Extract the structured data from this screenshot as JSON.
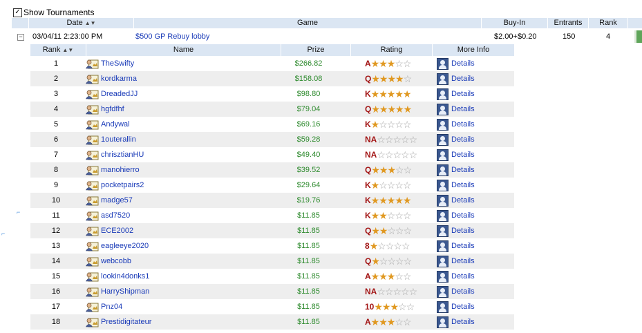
{
  "show_tournaments": {
    "label": "Show Tournaments",
    "checked": "✓"
  },
  "outer_headers": {
    "date": "Date",
    "game": "Game",
    "buyin": "Buy-In",
    "entrants": "Entrants",
    "rank": "Rank"
  },
  "tournament": {
    "expander": "−",
    "date": "03/04/11 2:23:00 PM",
    "game": "$500 GP Rebuy lobby",
    "buyin": "$2.00+$0.20",
    "entrants": "150",
    "rank": "4"
  },
  "inner_headers": {
    "rank": "Rank",
    "name": "Name",
    "prize": "Prize",
    "rating": "Rating",
    "more_info": "More Info"
  },
  "players": [
    {
      "rank": "1",
      "name": "TheSwifty",
      "prize": "$266.82",
      "grade": "A",
      "stars": 3,
      "details": "Details"
    },
    {
      "rank": "2",
      "name": "kordkarma",
      "prize": "$158.08",
      "grade": "Q",
      "stars": 4,
      "details": "Details"
    },
    {
      "rank": "3",
      "name": "DreadedJJ",
      "prize": "$98.80",
      "grade": "K",
      "stars": 5,
      "details": "Details"
    },
    {
      "rank": "4",
      "name": "hgfdfhf",
      "prize": "$79.04",
      "grade": "Q",
      "stars": 5,
      "details": "Details"
    },
    {
      "rank": "5",
      "name": "Andywal",
      "prize": "$69.16",
      "grade": "K",
      "stars": 1,
      "details": "Details"
    },
    {
      "rank": "6",
      "name": "1outerallin",
      "prize": "$59.28",
      "grade": "NA",
      "stars": 0,
      "details": "Details"
    },
    {
      "rank": "7",
      "name": "chrisztianHU",
      "prize": "$49.40",
      "grade": "NA",
      "stars": 0,
      "details": "Details"
    },
    {
      "rank": "8",
      "name": "manohierro",
      "prize": "$39.52",
      "grade": "Q",
      "stars": 3,
      "details": "Details"
    },
    {
      "rank": "9",
      "name": "pocketpairs2",
      "prize": "$29.64",
      "grade": "K",
      "stars": 1,
      "details": "Details"
    },
    {
      "rank": "10",
      "name": "madge57",
      "prize": "$19.76",
      "grade": "K",
      "stars": 5,
      "details": "Details"
    },
    {
      "rank": "11",
      "name": "asd7520",
      "prize": "$11.85",
      "grade": "K",
      "stars": 2,
      "details": "Details"
    },
    {
      "rank": "12",
      "name": "ECE2002",
      "prize": "$11.85",
      "grade": "Q",
      "stars": 2,
      "details": "Details"
    },
    {
      "rank": "13",
      "name": "eagleeye2020",
      "prize": "$11.85",
      "grade": "8",
      "stars": 1,
      "details": "Details"
    },
    {
      "rank": "14",
      "name": "webcobb",
      "prize": "$11.85",
      "grade": "Q",
      "stars": 1,
      "details": "Details"
    },
    {
      "rank": "15",
      "name": "lookin4donks1",
      "prize": "$11.85",
      "grade": "A",
      "stars": 3,
      "details": "Details"
    },
    {
      "rank": "16",
      "name": "HarryShipman",
      "prize": "$11.85",
      "grade": "NA",
      "stars": 0,
      "details": "Details"
    },
    {
      "rank": "17",
      "name": "Pnz04",
      "prize": "$11.85",
      "grade": "10",
      "stars": 3,
      "details": "Details"
    },
    {
      "rank": "18",
      "name": "Prestidigitateur",
      "prize": "$11.85",
      "grade": "A",
      "stars": 3,
      "details": "Details"
    }
  ],
  "colors": {
    "header_bg": "#dbe6f3",
    "link": "#1a3bb8",
    "prize": "#2d8a2d",
    "grade": "#a31616",
    "star_full": "#e09820",
    "star_empty": "#a8a8a8",
    "row_alt": "#eeeeee"
  },
  "icons": {
    "user_card": "user-card-icon",
    "profile": "profile-icon",
    "sort": "sort-arrows-icon",
    "expander": "collapse-icon"
  }
}
